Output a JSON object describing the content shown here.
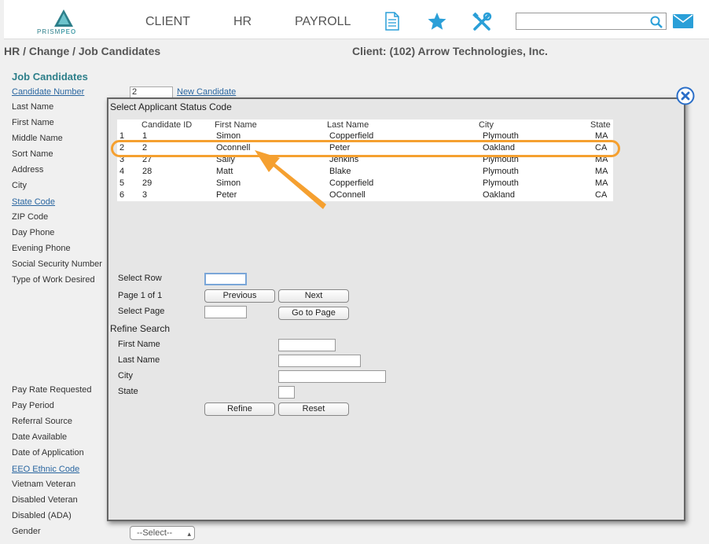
{
  "logo": {
    "text_a": "PRISM",
    "text_b": "PEO"
  },
  "nav": {
    "client": "CLIENT",
    "hr": "HR",
    "payroll": "PAYROLL"
  },
  "search": {
    "value": ""
  },
  "breadcrumb": "HR / Change / Job Candidates",
  "client": "Client: (102) Arrow Technologies, Inc.",
  "form": {
    "title": "Job Candidates",
    "candidate_number_label": "Candidate Number",
    "candidate_number_value": "2",
    "new_candidate": "New Candidate",
    "labels": {
      "last_name": "Last Name",
      "first_name": "First Name",
      "middle_name": "Middle Name",
      "sort_name": "Sort Name",
      "address": "Address",
      "city": "City",
      "state_code": "State Code",
      "zip_code": "ZIP Code",
      "day_phone": "Day Phone",
      "evening_phone": "Evening Phone",
      "ssn": "Social Security Number",
      "type_of_work": "Type of Work Desired",
      "pay_rate": "Pay Rate Requested",
      "pay_period": "Pay Period",
      "referral_source": "Referral Source",
      "date_available": "Date Available",
      "date_of_application": "Date of Application",
      "eeo_ethnic_code": "EEO Ethnic Code",
      "vietnam_veteran": "Vietnam Veteran",
      "disabled_veteran": "Disabled Veteran",
      "disabled_ada": "Disabled (ADA)",
      "gender": "Gender"
    },
    "gender_select": "--Select--"
  },
  "modal": {
    "title": "Select Applicant Status Code",
    "columns": [
      "Candidate ID",
      "First Name",
      "Last Name",
      "City",
      "State"
    ],
    "rows": [
      {
        "n": "1",
        "id": "1",
        "first": "Simon",
        "last": "Copperfield",
        "city": "Plymouth",
        "state": "MA"
      },
      {
        "n": "2",
        "id": "2",
        "first": "Oconnell",
        "last": "Peter",
        "city": "Oakland",
        "state": "CA"
      },
      {
        "n": "3",
        "id": "27",
        "first": "Sally",
        "last": "Jenkins",
        "city": "Plymouth",
        "state": "MA"
      },
      {
        "n": "4",
        "id": "28",
        "first": "Matt",
        "last": "Blake",
        "city": "Plymouth",
        "state": "MA"
      },
      {
        "n": "5",
        "id": "29",
        "first": "Simon",
        "last": "Copperfield",
        "city": "Plymouth",
        "state": "MA"
      },
      {
        "n": "6",
        "id": "3",
        "first": "Peter",
        "last": "OConnell",
        "city": "Oakland",
        "state": "CA"
      }
    ],
    "select_row_label": "Select Row",
    "select_row_value": "",
    "page_label": "Page 1 of 1",
    "previous": "Previous",
    "next": "Next",
    "select_page_label": "Select Page",
    "select_page_value": "",
    "go_to_page": "Go to Page",
    "refine_title": "Refine Search",
    "refine_first_name": "First Name",
    "refine_last_name": "Last Name",
    "refine_city": "City",
    "refine_state": "State",
    "refine": "Refine",
    "reset": "Reset"
  },
  "colors": {
    "accent": "#2d7f8a",
    "link": "#2a66a0",
    "highlight": "#f5a030",
    "icon_blue": "#2a9fd8"
  }
}
